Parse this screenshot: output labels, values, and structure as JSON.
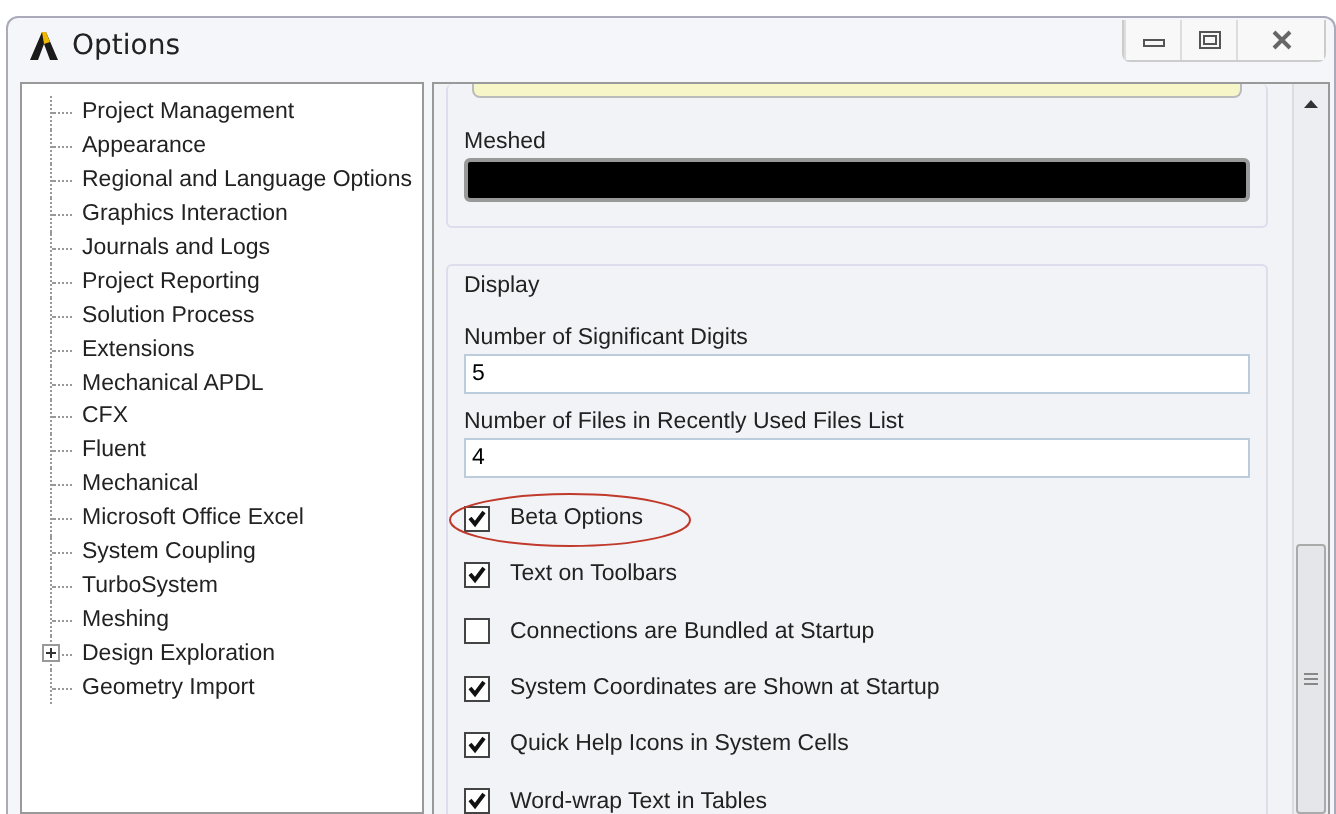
{
  "window": {
    "title": "Options"
  },
  "tree": [
    {
      "label": "Project Management"
    },
    {
      "label": "Appearance"
    },
    {
      "label": "Regional and Language Options"
    },
    {
      "label": "Graphics Interaction"
    },
    {
      "label": "Journals and Logs"
    },
    {
      "label": "Project Reporting"
    },
    {
      "label": "Solution Process"
    },
    {
      "label": "Extensions"
    },
    {
      "label": "Mechanical APDL"
    },
    {
      "label": "CFX"
    },
    {
      "label": "Fluent"
    },
    {
      "label": "Mechanical"
    },
    {
      "label": "Microsoft Office Excel"
    },
    {
      "label": "System Coupling"
    },
    {
      "label": "TurboSystem"
    },
    {
      "label": "Meshing"
    },
    {
      "label": "Design Exploration",
      "expandable": true
    },
    {
      "label": "Geometry Import"
    }
  ],
  "meshed": {
    "label": "Meshed"
  },
  "display": {
    "title": "Display",
    "fields": [
      {
        "label": "Number of Significant Digits",
        "value": "5"
      },
      {
        "label": "Number of Files in Recently Used Files List",
        "value": "4"
      }
    ],
    "checkboxes": [
      {
        "label": "Beta Options",
        "checked": true,
        "circled": true
      },
      {
        "label": "Text on Toolbars",
        "checked": true,
        "circled": false
      },
      {
        "label": "Connections are Bundled at Startup",
        "checked": false,
        "circled": false
      },
      {
        "label": "System Coordinates are Shown at Startup",
        "checked": true,
        "circled": false
      },
      {
        "label": "Quick Help Icons in System Cells",
        "checked": true,
        "circled": false
      },
      {
        "label": "Word-wrap Text in Tables",
        "checked": true,
        "circled": false
      }
    ]
  }
}
